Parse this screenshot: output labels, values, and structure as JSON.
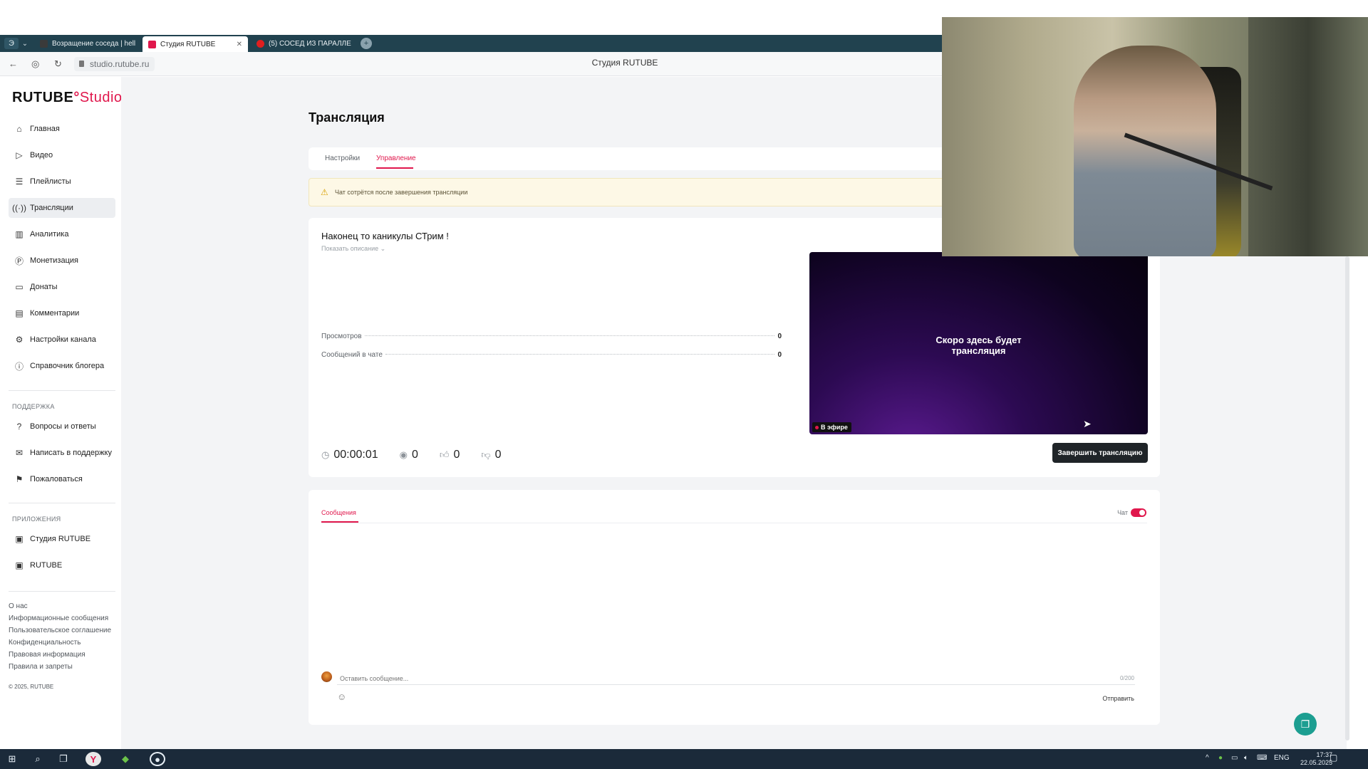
{
  "browser": {
    "tabs": [
      {
        "label": "Возращение соседа | hell",
        "favicon_color": "#3a3a3a"
      },
      {
        "label": "Студия RUTUBE",
        "favicon_color": "#e0174c"
      },
      {
        "label": "(5) СОСЕД ИЗ ПАРАЛЛЕ",
        "favicon_color": "#e01f1f"
      }
    ],
    "url": "studio.rutube.ru",
    "page_title": "Студия RUTUBE"
  },
  "logo": {
    "rutube": "RUTUBE",
    "studio": "Studio"
  },
  "sidebar": {
    "items": [
      {
        "label": "Главная",
        "icon": "home-icon"
      },
      {
        "label": "Видео",
        "icon": "video-icon"
      },
      {
        "label": "Плейлисты",
        "icon": "playlist-icon"
      },
      {
        "label": "Трансляции",
        "icon": "broadcast-icon"
      },
      {
        "label": "Аналитика",
        "icon": "analytics-icon"
      },
      {
        "label": "Монетизация",
        "icon": "monetization-icon"
      },
      {
        "label": "Донаты",
        "icon": "donate-icon"
      },
      {
        "label": "Комментарии",
        "icon": "comments-icon"
      },
      {
        "label": "Настройки канала",
        "icon": "settings-icon"
      },
      {
        "label": "Справочник блогера",
        "icon": "info-icon"
      }
    ],
    "support_title": "Поддержка",
    "support_items": [
      {
        "label": "Вопросы и ответы",
        "icon": "question-icon"
      },
      {
        "label": "Написать в поддержку",
        "icon": "mail-icon"
      },
      {
        "label": "Пожаловаться",
        "icon": "flag-icon"
      }
    ],
    "apps_title": "Приложения",
    "apps_items": [
      {
        "label": "Студия RUTUBE",
        "icon": "studio-app-icon"
      },
      {
        "label": "RUTUBE",
        "icon": "rutube-app-icon"
      }
    ],
    "footer_links": [
      "О нас",
      "Информационные сообщения",
      "Пользовательское соглашение",
      "Конфиденциальность",
      "Правовая информация",
      "Правила и запреты"
    ],
    "copyright": "© 2025, RUTUBE"
  },
  "main": {
    "heading": "Трансляция",
    "tabs": [
      "Настройки",
      "Управление"
    ],
    "warning": "Чат сотрётся после завершения трансляции",
    "stream": {
      "title": "Наконец то каникулы СТрим !",
      "show_description": "Показать описание ⌄",
      "stats": [
        {
          "label": "Просмотров",
          "value": "0"
        },
        {
          "label": "Сообщений в чате",
          "value": "0"
        }
      ],
      "player_message_line1": "Скоро здесь будет",
      "player_message_line2": "трансляция",
      "live_badge": "В эфире",
      "timer": "00:00:01",
      "viewers": "0",
      "likes": "0",
      "dislikes": "0",
      "end_button": "Завершить трансляцию"
    },
    "chat": {
      "tab": "Сообщения",
      "toggle_label": "Чат",
      "toggle_on": true,
      "input_placeholder": "Оставить сообщение...",
      "counter": "0/200",
      "send": "Отправить"
    }
  },
  "taskbar": {
    "lang": "ENG",
    "time": "17:37",
    "date": "22.05.2025"
  },
  "colors": {
    "accent": "#e0174c",
    "sidebar_active": "#eceef1",
    "tabbar": "#21424f",
    "taskbar": "#1b2a3a"
  }
}
